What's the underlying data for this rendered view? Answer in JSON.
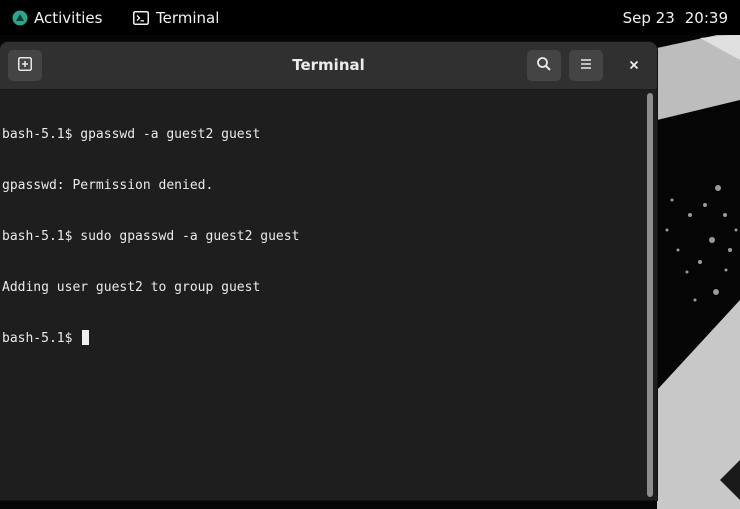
{
  "topbar": {
    "activities_label": "Activities",
    "app_label": "Terminal",
    "date": "Sep 23",
    "time": "20:39"
  },
  "window": {
    "title": "Terminal",
    "new_tab_icon": "new-tab-icon",
    "search_icon": "search-icon",
    "menu_icon": "hamburger-menu-icon",
    "close_icon": "close-icon"
  },
  "terminal": {
    "lines": [
      "bash-5.1$ gpasswd -a guest2 guest",
      "gpasswd: Permission denied.",
      "bash-5.1$ sudo gpasswd -a guest2 guest",
      "Adding user guest2 to group guest",
      "bash-5.1$ "
    ]
  },
  "colors": {
    "accent": "#2ca58d",
    "headerbar": "#303030",
    "terminal_bg": "#1e1e1e",
    "text": "#eaeaea"
  }
}
